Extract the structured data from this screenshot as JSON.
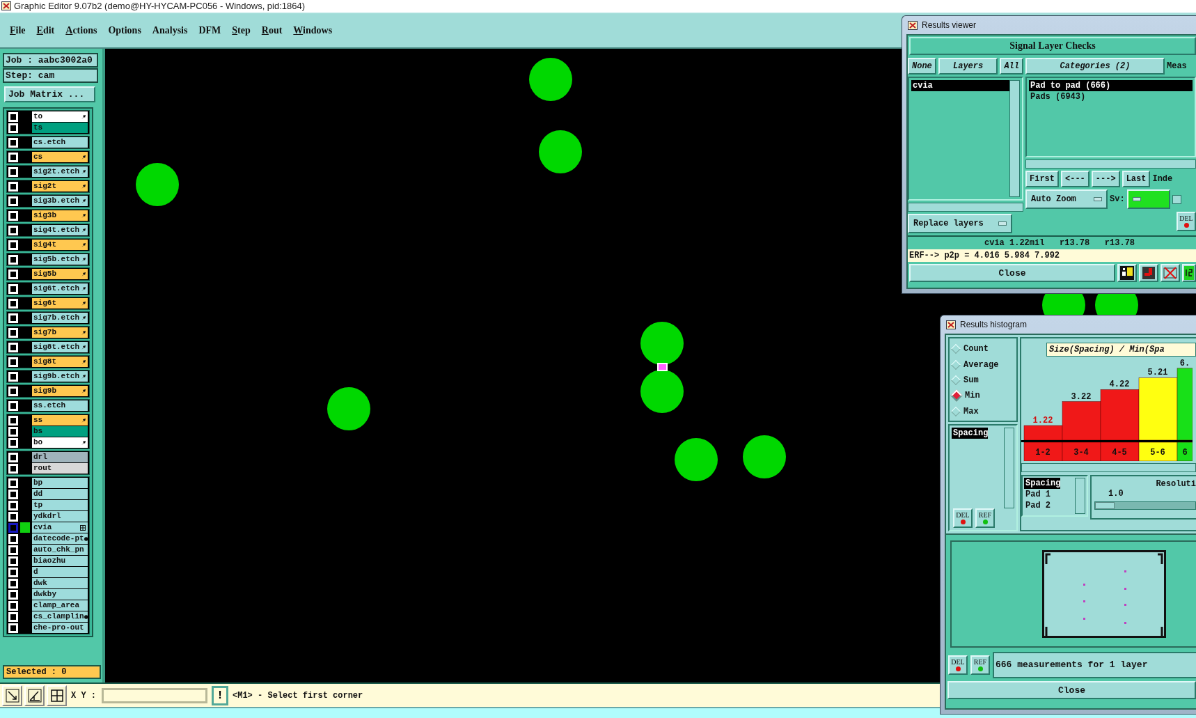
{
  "window": {
    "title": "Graphic Editor 9.07b2 (demo@HY-HYCAM-PC056 - Windows, pid:1864)"
  },
  "menu": [
    {
      "label": "File",
      "mnemonic": true
    },
    {
      "label": "Edit",
      "mnemonic": true
    },
    {
      "label": "Actions",
      "mnemonic": true
    },
    {
      "label": "Options",
      "mnemonic": false
    },
    {
      "label": "Analysis",
      "mnemonic": false
    },
    {
      "label": "DFM",
      "mnemonic": false
    },
    {
      "label": "Step",
      "mnemonic": true
    },
    {
      "label": "Rout",
      "mnemonic": true
    },
    {
      "label": "Windows",
      "mnemonic": true
    }
  ],
  "job_panel": {
    "job": "Job : aabc3002a0",
    "step": "Step: cam",
    "matrix_button": "Job Matrix ...",
    "selected": "Selected : 0",
    "layer_groups": [
      {
        "layers": [
          {
            "name": "to",
            "color": "#ffffff",
            "kind": "arrow",
            "checked": false,
            "active": false
          },
          {
            "name": "ts",
            "color": "#00a080",
            "kind": "plain",
            "checked": false,
            "active": false
          }
        ]
      },
      {
        "layers": [
          {
            "name": "cs.etch",
            "color": "#9edcdc",
            "kind": "plain",
            "checked": false,
            "active": false
          }
        ]
      },
      {
        "layers": [
          {
            "name": "cs",
            "color": "#ffc850",
            "kind": "arrow",
            "checked": false,
            "active": false
          }
        ]
      },
      {
        "layers": [
          {
            "name": "sig2t.etch",
            "color": "#9edcdc",
            "kind": "arrow",
            "checked": false,
            "active": false
          }
        ]
      },
      {
        "layers": [
          {
            "name": "sig2t",
            "color": "#ffc850",
            "kind": "arrow",
            "checked": false,
            "active": false
          }
        ]
      },
      {
        "layers": [
          {
            "name": "sig3b.etch",
            "color": "#9edcdc",
            "kind": "arrow",
            "checked": false,
            "active": false
          }
        ]
      },
      {
        "layers": [
          {
            "name": "sig3b",
            "color": "#ffc850",
            "kind": "arrow",
            "checked": false,
            "active": false
          }
        ]
      },
      {
        "layers": [
          {
            "name": "sig4t.etch",
            "color": "#9edcdc",
            "kind": "arrow",
            "checked": false,
            "active": false
          }
        ]
      },
      {
        "layers": [
          {
            "name": "sig4t",
            "color": "#ffc850",
            "kind": "arrow",
            "checked": false,
            "active": false
          }
        ]
      },
      {
        "layers": [
          {
            "name": "sig5b.etch",
            "color": "#9edcdc",
            "kind": "arrow",
            "checked": false,
            "active": false
          }
        ]
      },
      {
        "layers": [
          {
            "name": "sig5b",
            "color": "#ffc850",
            "kind": "arrow",
            "checked": false,
            "active": false
          }
        ]
      },
      {
        "layers": [
          {
            "name": "sig6t.etch",
            "color": "#9edcdc",
            "kind": "arrow",
            "checked": false,
            "active": false
          }
        ]
      },
      {
        "layers": [
          {
            "name": "sig6t",
            "color": "#ffc850",
            "kind": "arrow",
            "checked": false,
            "active": false
          }
        ]
      },
      {
        "layers": [
          {
            "name": "sig7b.etch",
            "color": "#9edcdc",
            "kind": "arrow",
            "checked": false,
            "active": false
          }
        ]
      },
      {
        "layers": [
          {
            "name": "sig7b",
            "color": "#ffc850",
            "kind": "arrow",
            "checked": false,
            "active": false
          }
        ]
      },
      {
        "layers": [
          {
            "name": "sig8t.etch",
            "color": "#9edcdc",
            "kind": "arrow",
            "checked": false,
            "active": false
          }
        ]
      },
      {
        "layers": [
          {
            "name": "sig8t",
            "color": "#ffc850",
            "kind": "arrow",
            "checked": false,
            "active": false
          }
        ]
      },
      {
        "layers": [
          {
            "name": "sig9b.etch",
            "color": "#9edcdc",
            "kind": "arrow",
            "checked": false,
            "active": false
          }
        ]
      },
      {
        "layers": [
          {
            "name": "sig9b",
            "color": "#ffc850",
            "kind": "arrow",
            "checked": false,
            "active": false
          }
        ]
      },
      {
        "layers": [
          {
            "name": "ss.etch",
            "color": "#9edcdc",
            "kind": "plain",
            "checked": false,
            "active": false
          }
        ]
      },
      {
        "layers": [
          {
            "name": "ss",
            "color": "#ffc850",
            "kind": "arrow",
            "checked": false,
            "active": false
          },
          {
            "name": "bs",
            "color": "#00a080",
            "kind": "plain",
            "checked": false,
            "active": false
          },
          {
            "name": "bo",
            "color": "#ffffff",
            "kind": "arrow",
            "checked": false,
            "active": false
          }
        ]
      },
      {
        "layers": [
          {
            "name": "drl",
            "color": "#a0b4bc",
            "kind": "plain",
            "checked": false,
            "active": false
          },
          {
            "name": "rout",
            "color": "#d8d8d8",
            "kind": "plain",
            "checked": false,
            "active": false
          }
        ]
      },
      {
        "layers": [
          {
            "name": "bp",
            "color": "#9edcdc",
            "kind": "plain",
            "checked": false,
            "active": false
          },
          {
            "name": "dd",
            "color": "#9edcdc",
            "kind": "plain",
            "checked": false,
            "active": false
          },
          {
            "name": "tp",
            "color": "#9edcdc",
            "kind": "plain",
            "checked": false,
            "active": false
          },
          {
            "name": "ydkdrl",
            "color": "#9edcdc",
            "kind": "plain",
            "checked": false,
            "active": false
          },
          {
            "name": "cvia",
            "color": "#9edcdc",
            "kind": "grid",
            "checked": false,
            "active": true
          },
          {
            "name": "datecode-pt",
            "color": "#9edcdc",
            "kind": "dot",
            "checked": false,
            "active": false
          },
          {
            "name": "auto_chk_pn",
            "color": "#9edcdc",
            "kind": "plain",
            "checked": false,
            "active": false
          },
          {
            "name": "biaozhu",
            "color": "#9edcdc",
            "kind": "plain",
            "checked": false,
            "active": false
          },
          {
            "name": "d",
            "color": "#9edcdc",
            "kind": "plain",
            "checked": false,
            "active": false
          },
          {
            "name": "dwk",
            "color": "#9edcdc",
            "kind": "plain",
            "checked": false,
            "active": false
          },
          {
            "name": "dwkby",
            "color": "#9edcdc",
            "kind": "plain",
            "checked": false,
            "active": false
          },
          {
            "name": "clamp_area",
            "color": "#9edcdc",
            "kind": "plain",
            "checked": false,
            "active": false
          },
          {
            "name": "cs_clamplin",
            "color": "#9edcdc",
            "kind": "dot",
            "checked": false,
            "active": false
          },
          {
            "name": "che-pro-out",
            "color": "#9edcdc",
            "kind": "plain",
            "checked": false,
            "active": false
          }
        ]
      }
    ]
  },
  "bottom_bar": {
    "xy_label": "X Y :",
    "alert_button": "!",
    "prompt": "<M1> - Select first corner"
  },
  "results_viewer": {
    "title": "Results viewer",
    "header": "Signal Layer Checks",
    "layer_buttons": [
      "None",
      "Layers",
      "All"
    ],
    "layers": [
      {
        "name": "cvia",
        "selected": true
      }
    ],
    "categories_button": "Categories (2)",
    "column_cut": "Meas",
    "categories": [
      {
        "label": "Pad to pad (666)",
        "selected": true
      },
      {
        "label": "Pads (6943)",
        "selected": false
      }
    ],
    "nav_buttons": [
      "First",
      "<---",
      "--->",
      "Last"
    ],
    "index_label": "Inde",
    "auto_zoom": "Auto Zoom",
    "sv_label": "Sv:",
    "sv_option": {
      "checked": false
    },
    "replace_layers": "Replace layers",
    "del_button": "DEL",
    "info_line": "cvia 1.22mil   r13.78   r13.78",
    "erf_line": "ERF--> p2p = 4.016 5.984 7.992",
    "close": "Close"
  },
  "results_histogram": {
    "title": "Results histogram",
    "modes": [
      {
        "label": "Count",
        "selected": false
      },
      {
        "label": "Average",
        "selected": false
      },
      {
        "label": "Sum",
        "selected": false
      },
      {
        "label": "Min",
        "selected": true
      },
      {
        "label": "Max",
        "selected": false
      }
    ],
    "measures": [
      {
        "label": "Spacing",
        "selected": true
      }
    ],
    "del_button": "DEL",
    "ref_button": "REF",
    "chart_data": {
      "type": "bar",
      "title": "Size(Spacing) / Min(Spa",
      "categories": [
        "1-2",
        "3-4",
        "4-5",
        "5-6",
        "6"
      ],
      "values": [
        1.22,
        3.22,
        4.22,
        5.21,
        6.0
      ],
      "value_labels": [
        "1.22",
        "3.22",
        "4.22",
        "5.21",
        "6."
      ]
    },
    "bars": [
      {
        "color": "#f01818",
        "alert": true
      },
      {
        "color": "#f01818",
        "alert": false
      },
      {
        "color": "#f01818",
        "alert": false
      },
      {
        "color": "#ffff10",
        "alert": false
      },
      {
        "color": "#18e018",
        "alert": false
      }
    ],
    "fields": [
      {
        "label": "Spacing",
        "selected": true
      },
      {
        "label": "Pad 1",
        "selected": false
      },
      {
        "label": "Pad 2",
        "selected": false
      }
    ],
    "resolution_label": "Resoluti",
    "resolution_value": "1.0",
    "resolution": {
      "level": 0.1
    },
    "status_del_button": "DEL",
    "status_ref_button": "REF",
    "status": "666 measurements for 1 layer",
    "close": "Close"
  }
}
